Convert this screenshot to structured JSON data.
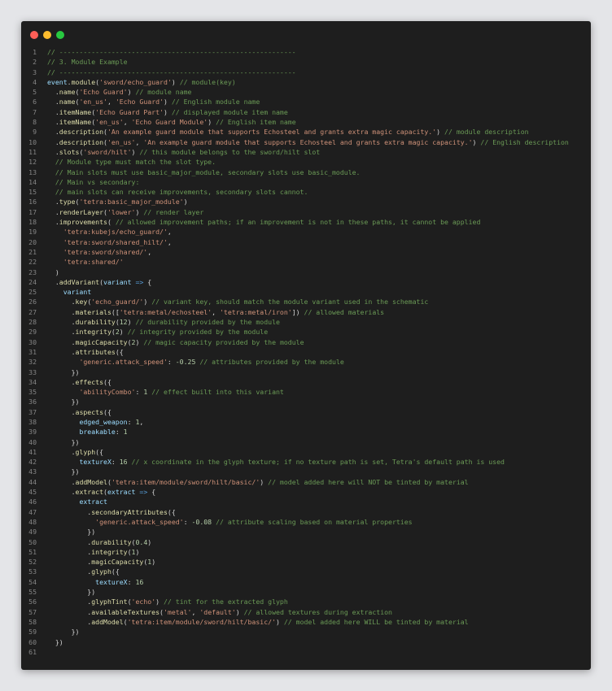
{
  "window": {
    "controls": [
      "close",
      "minimize",
      "maximize"
    ],
    "colors": {
      "background": "#1e1e1e",
      "close": "#ff5f57",
      "minimize": "#febc2e",
      "maximize": "#28c840"
    }
  },
  "code": {
    "language": "javascript",
    "lines": [
      [
        [
          "c",
          "// -----------------------------------------------------------"
        ]
      ],
      [
        [
          "c",
          "// 3. Module Example"
        ]
      ],
      [
        [
          "c",
          "// -----------------------------------------------------------"
        ]
      ],
      [
        [
          "v",
          "event"
        ],
        [
          "p",
          "."
        ],
        [
          "f",
          "module"
        ],
        [
          "p",
          "("
        ],
        [
          "s",
          "'sword/echo_guard'"
        ],
        [
          "p",
          ") "
        ],
        [
          "c",
          "// module(key)"
        ]
      ],
      [
        [
          "p",
          "  ."
        ],
        [
          "f",
          "name"
        ],
        [
          "p",
          "("
        ],
        [
          "s",
          "'Echo Guard'"
        ],
        [
          "p",
          ") "
        ],
        [
          "c",
          "// module name"
        ]
      ],
      [
        [
          "p",
          "  ."
        ],
        [
          "f",
          "name"
        ],
        [
          "p",
          "("
        ],
        [
          "s",
          "'en_us'"
        ],
        [
          "p",
          ", "
        ],
        [
          "s",
          "'Echo Guard'"
        ],
        [
          "p",
          ") "
        ],
        [
          "c",
          "// English module name"
        ]
      ],
      [
        [
          "p",
          "  ."
        ],
        [
          "f",
          "itemName"
        ],
        [
          "p",
          "("
        ],
        [
          "s",
          "'Echo Guard Part'"
        ],
        [
          "p",
          ") "
        ],
        [
          "c",
          "// displayed module item name"
        ]
      ],
      [
        [
          "p",
          "  ."
        ],
        [
          "f",
          "itemName"
        ],
        [
          "p",
          "("
        ],
        [
          "s",
          "'en_us'"
        ],
        [
          "p",
          ", "
        ],
        [
          "s",
          "'Echo Guard Module'"
        ],
        [
          "p",
          ") "
        ],
        [
          "c",
          "// English item name"
        ]
      ],
      [
        [
          "p",
          "  ."
        ],
        [
          "f",
          "description"
        ],
        [
          "p",
          "("
        ],
        [
          "s",
          "'An example guard module that supports Echosteel and grants extra magic capacity.'"
        ],
        [
          "p",
          ") "
        ],
        [
          "c",
          "// module description"
        ]
      ],
      [
        [
          "p",
          "  ."
        ],
        [
          "f",
          "description"
        ],
        [
          "p",
          "("
        ],
        [
          "s",
          "'en_us'"
        ],
        [
          "p",
          ", "
        ],
        [
          "s",
          "'An example guard module that supports Echosteel and grants extra magic capacity.'"
        ],
        [
          "p",
          ") "
        ],
        [
          "c",
          "// English description"
        ]
      ],
      [
        [
          "p",
          "  ."
        ],
        [
          "f",
          "slots"
        ],
        [
          "p",
          "("
        ],
        [
          "s",
          "'sword/hilt'"
        ],
        [
          "p",
          ") "
        ],
        [
          "c",
          "// this module belongs to the sword/hilt slot"
        ]
      ],
      [
        [
          "c",
          "  // Module type must match the slot type."
        ]
      ],
      [
        [
          "c",
          "  // Main slots must use basic_major_module, secondary slots use basic_module."
        ]
      ],
      [
        [
          "c",
          "  // Main vs secondary:"
        ]
      ],
      [
        [
          "c",
          "  // main slots can receive improvements, secondary slots cannot."
        ]
      ],
      [
        [
          "p",
          "  ."
        ],
        [
          "f",
          "type"
        ],
        [
          "p",
          "("
        ],
        [
          "s",
          "'tetra:basic_major_module'"
        ],
        [
          "p",
          ")"
        ]
      ],
      [
        [
          "p",
          "  ."
        ],
        [
          "f",
          "renderLayer"
        ],
        [
          "p",
          "("
        ],
        [
          "s",
          "'lower'"
        ],
        [
          "p",
          ") "
        ],
        [
          "c",
          "// render layer"
        ]
      ],
      [
        [
          "p",
          "  ."
        ],
        [
          "f",
          "improvements"
        ],
        [
          "p",
          "( "
        ],
        [
          "c",
          "// allowed improvement paths; if an improvement is not in these paths, it cannot be applied"
        ]
      ],
      [
        [
          "p",
          "    "
        ],
        [
          "s",
          "'tetra:kubejs/echo_guard/'"
        ],
        [
          "p",
          ","
        ]
      ],
      [
        [
          "p",
          "    "
        ],
        [
          "s",
          "'tetra:sword/shared_hilt/'"
        ],
        [
          "p",
          ","
        ]
      ],
      [
        [
          "p",
          "    "
        ],
        [
          "s",
          "'tetra:sword/shared/'"
        ],
        [
          "p",
          ","
        ]
      ],
      [
        [
          "p",
          "    "
        ],
        [
          "s",
          "'tetra:shared/'"
        ]
      ],
      [
        [
          "p",
          "  )"
        ]
      ],
      [
        [
          "p",
          "  ."
        ],
        [
          "f",
          "addVariant"
        ],
        [
          "p",
          "("
        ],
        [
          "v",
          "variant"
        ],
        [
          "p",
          " "
        ],
        [
          "k",
          "=>"
        ],
        [
          "p",
          " {"
        ]
      ],
      [
        [
          "p",
          "    "
        ],
        [
          "v",
          "variant"
        ]
      ],
      [
        [
          "p",
          "      ."
        ],
        [
          "f",
          "key"
        ],
        [
          "p",
          "("
        ],
        [
          "s",
          "'echo_guard/'"
        ],
        [
          "p",
          ") "
        ],
        [
          "c",
          "// variant key, should match the module variant used in the schematic"
        ]
      ],
      [
        [
          "p",
          "      ."
        ],
        [
          "f",
          "materials"
        ],
        [
          "p",
          "(["
        ],
        [
          "s",
          "'tetra:metal/echosteel'"
        ],
        [
          "p",
          ", "
        ],
        [
          "s",
          "'tetra:metal/iron'"
        ],
        [
          "p",
          "]) "
        ],
        [
          "c",
          "// allowed materials"
        ]
      ],
      [
        [
          "p",
          "      ."
        ],
        [
          "f",
          "durability"
        ],
        [
          "p",
          "("
        ],
        [
          "n",
          "12"
        ],
        [
          "p",
          ") "
        ],
        [
          "c",
          "// durability provided by the module"
        ]
      ],
      [
        [
          "p",
          "      ."
        ],
        [
          "f",
          "integrity"
        ],
        [
          "p",
          "("
        ],
        [
          "n",
          "2"
        ],
        [
          "p",
          ") "
        ],
        [
          "c",
          "// integrity provided by the module"
        ]
      ],
      [
        [
          "p",
          "      ."
        ],
        [
          "f",
          "magicCapacity"
        ],
        [
          "p",
          "("
        ],
        [
          "n",
          "2"
        ],
        [
          "p",
          ") "
        ],
        [
          "c",
          "// magic capacity provided by the module"
        ]
      ],
      [
        [
          "p",
          "      ."
        ],
        [
          "f",
          "attributes"
        ],
        [
          "p",
          "({"
        ]
      ],
      [
        [
          "p",
          "        "
        ],
        [
          "s",
          "'generic.attack_speed'"
        ],
        [
          "p",
          ": "
        ],
        [
          "n",
          "-0.25"
        ],
        [
          "p",
          " "
        ],
        [
          "c",
          "// attributes provided by the module"
        ]
      ],
      [
        [
          "p",
          "      })"
        ]
      ],
      [
        [
          "p",
          "      ."
        ],
        [
          "f",
          "effects"
        ],
        [
          "p",
          "({"
        ]
      ],
      [
        [
          "p",
          "        "
        ],
        [
          "s",
          "'abilityCombo'"
        ],
        [
          "p",
          ": "
        ],
        [
          "n",
          "1"
        ],
        [
          "p",
          " "
        ],
        [
          "c",
          "// effect built into this variant"
        ]
      ],
      [
        [
          "p",
          "      })"
        ]
      ],
      [
        [
          "p",
          "      ."
        ],
        [
          "f",
          "aspects"
        ],
        [
          "p",
          "({"
        ]
      ],
      [
        [
          "p",
          "        "
        ],
        [
          "v",
          "edged_weapon"
        ],
        [
          "p",
          ": "
        ],
        [
          "n",
          "1"
        ],
        [
          "p",
          ","
        ]
      ],
      [
        [
          "p",
          "        "
        ],
        [
          "v",
          "breakable"
        ],
        [
          "p",
          ": "
        ],
        [
          "n",
          "1"
        ]
      ],
      [
        [
          "p",
          "      })"
        ]
      ],
      [
        [
          "p",
          "      ."
        ],
        [
          "f",
          "glyph"
        ],
        [
          "p",
          "({"
        ]
      ],
      [
        [
          "p",
          "        "
        ],
        [
          "v",
          "textureX"
        ],
        [
          "p",
          ": "
        ],
        [
          "n",
          "16"
        ],
        [
          "p",
          " "
        ],
        [
          "c",
          "// x coordinate in the glyph texture; if no texture path is set, Tetra's default path is used"
        ]
      ],
      [
        [
          "p",
          "      })"
        ]
      ],
      [
        [
          "p",
          "      ."
        ],
        [
          "f",
          "addModel"
        ],
        [
          "p",
          "("
        ],
        [
          "s",
          "'tetra:item/module/sword/hilt/basic/'"
        ],
        [
          "p",
          ") "
        ],
        [
          "c",
          "// model added here will NOT be tinted by material"
        ]
      ],
      [
        [
          "p",
          "      ."
        ],
        [
          "f",
          "extract"
        ],
        [
          "p",
          "("
        ],
        [
          "v",
          "extract"
        ],
        [
          "p",
          " "
        ],
        [
          "k",
          "=>"
        ],
        [
          "p",
          " {"
        ]
      ],
      [
        [
          "p",
          "        "
        ],
        [
          "v",
          "extract"
        ]
      ],
      [
        [
          "p",
          "          ."
        ],
        [
          "f",
          "secondaryAttributes"
        ],
        [
          "p",
          "({"
        ]
      ],
      [
        [
          "p",
          "            "
        ],
        [
          "s",
          "'generic.attack_speed'"
        ],
        [
          "p",
          ": "
        ],
        [
          "n",
          "-0.08"
        ],
        [
          "p",
          " "
        ],
        [
          "c",
          "// attribute scaling based on material properties"
        ]
      ],
      [
        [
          "p",
          "          })"
        ]
      ],
      [
        [
          "p",
          "          ."
        ],
        [
          "f",
          "durability"
        ],
        [
          "p",
          "("
        ],
        [
          "n",
          "0.4"
        ],
        [
          "p",
          ")"
        ]
      ],
      [
        [
          "p",
          "          ."
        ],
        [
          "f",
          "integrity"
        ],
        [
          "p",
          "("
        ],
        [
          "n",
          "1"
        ],
        [
          "p",
          ")"
        ]
      ],
      [
        [
          "p",
          "          ."
        ],
        [
          "f",
          "magicCapacity"
        ],
        [
          "p",
          "("
        ],
        [
          "n",
          "1"
        ],
        [
          "p",
          ")"
        ]
      ],
      [
        [
          "p",
          "          ."
        ],
        [
          "f",
          "glyph"
        ],
        [
          "p",
          "({"
        ]
      ],
      [
        [
          "p",
          "            "
        ],
        [
          "v",
          "textureX"
        ],
        [
          "p",
          ": "
        ],
        [
          "n",
          "16"
        ]
      ],
      [
        [
          "p",
          "          })"
        ]
      ],
      [
        [
          "p",
          "          ."
        ],
        [
          "f",
          "glyphTint"
        ],
        [
          "p",
          "("
        ],
        [
          "s",
          "'echo'"
        ],
        [
          "p",
          ") "
        ],
        [
          "c",
          "// tint for the extracted glyph"
        ]
      ],
      [
        [
          "p",
          "          ."
        ],
        [
          "f",
          "availableTextures"
        ],
        [
          "p",
          "("
        ],
        [
          "s",
          "'metal'"
        ],
        [
          "p",
          ", "
        ],
        [
          "s",
          "'default'"
        ],
        [
          "p",
          ") "
        ],
        [
          "c",
          "// allowed textures during extraction"
        ]
      ],
      [
        [
          "p",
          "          ."
        ],
        [
          "f",
          "addModel"
        ],
        [
          "p",
          "("
        ],
        [
          "s",
          "'tetra:item/module/sword/hilt/basic/'"
        ],
        [
          "p",
          ") "
        ],
        [
          "c",
          "// model added here WILL be tinted by material"
        ]
      ],
      [
        [
          "p",
          "      })"
        ]
      ],
      [
        [
          "p",
          "  })"
        ]
      ],
      []
    ]
  }
}
